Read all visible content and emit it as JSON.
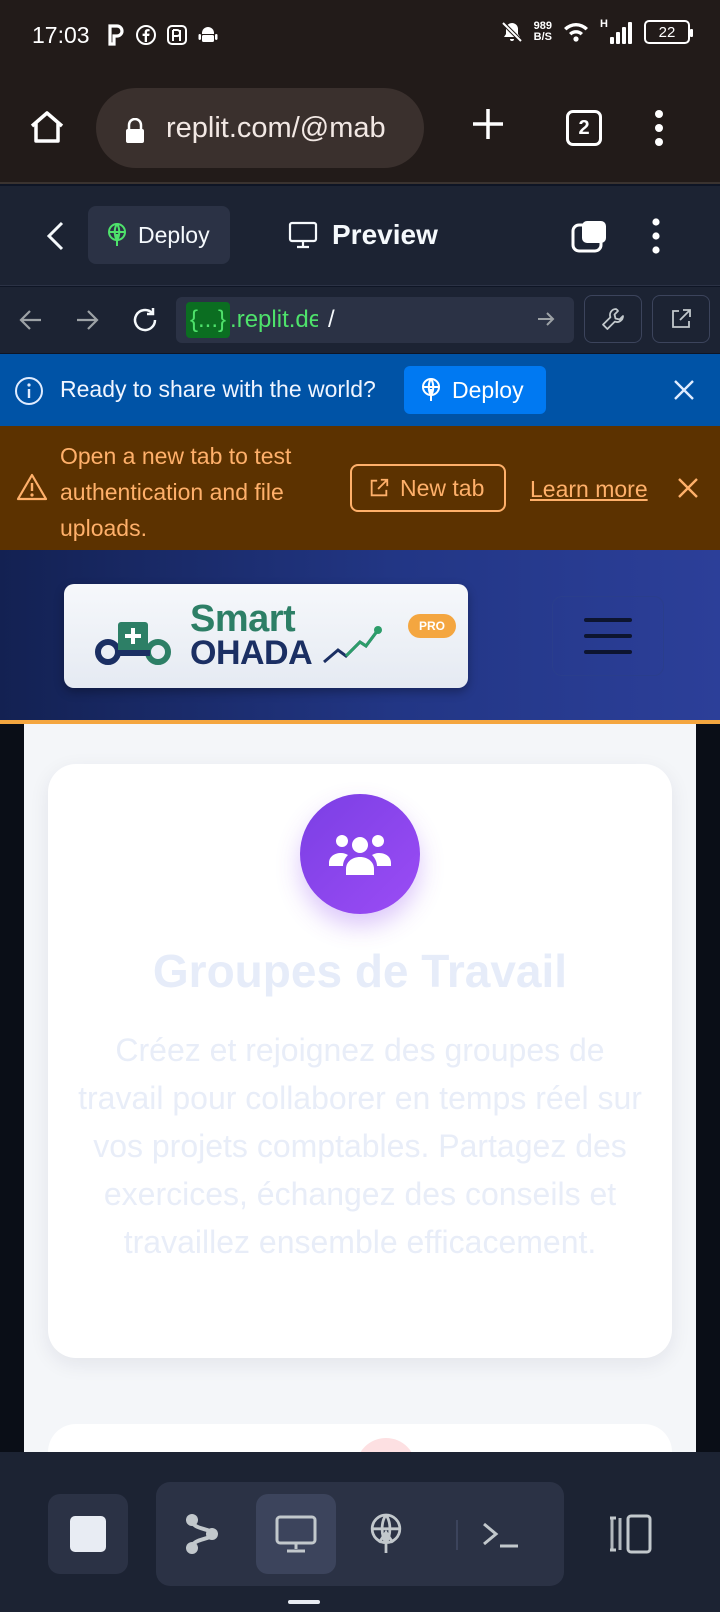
{
  "status_bar": {
    "time": "17:03",
    "netspeed_value": "989",
    "netspeed_unit": "B/S",
    "network_type": "H",
    "battery": "22"
  },
  "browser": {
    "url": "replit.com/@mab",
    "tab_count": "2"
  },
  "replit_bar": {
    "deploy_label": "Deploy",
    "preview_label": "Preview"
  },
  "webview": {
    "address_tag": "{...}",
    "address_host": ".replit.dev",
    "address_path": "/"
  },
  "deploy_banner": {
    "message": "Ready to share with the world?",
    "button_label": "Deploy"
  },
  "auth_banner": {
    "message": "Open a new tab to test authentication and file uploads.",
    "new_tab_label": "New tab",
    "learn_more_label": "Learn more"
  },
  "site": {
    "logo_line1": "Smart",
    "logo_line2": "OHADA",
    "logo_badge": "PRO"
  },
  "feature_card": {
    "icon": "users-icon",
    "title": "Groupes de Travail",
    "description": "Créez et rejoignez des groupes de travail pour collaborer en temps réel sur vos projets comptables. Partagez des exercices, échangez des conseils et travaillez ensemble efficacement."
  },
  "colors": {
    "replit_bg": "#1c2333",
    "deploy_banner": "#0053a6",
    "auth_banner": "#5c3200",
    "accent_orange": "#f4a640",
    "feature_purple": "#8b45ee"
  }
}
